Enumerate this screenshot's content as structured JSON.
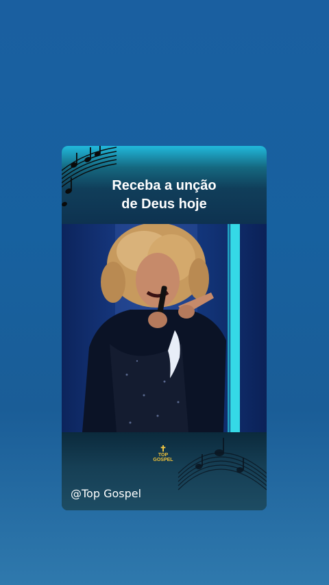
{
  "card": {
    "title_line1": "Receba a unção",
    "title_line2": "de Deus hoje",
    "handle": "@Top Gospel",
    "logo_line1": "TOP",
    "logo_line2": "GOSPEL",
    "logo_icon": "cross-icon"
  },
  "colors": {
    "background": "#1a5fa0",
    "header_accent": "#21b9dc",
    "footer": "#163f55",
    "logo": "#f0c23a"
  }
}
